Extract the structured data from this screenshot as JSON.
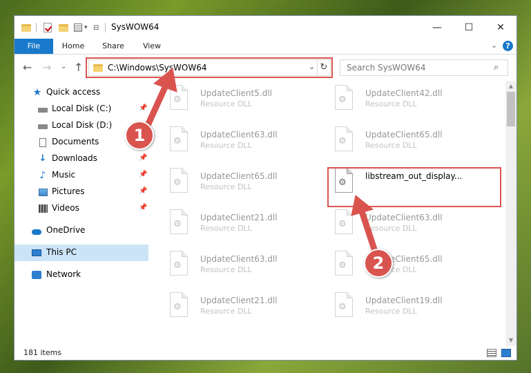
{
  "window": {
    "title": "SysWOW64",
    "controls": {
      "minimize": "—",
      "maximize": "☐",
      "close": "✕"
    }
  },
  "ribbon": {
    "tabs": [
      "File",
      "Home",
      "Share",
      "View"
    ],
    "expand_glyph": "⌄"
  },
  "nav": {
    "back": "←",
    "forward": "→",
    "recent": "⌄",
    "up": "↑",
    "address": "C:\\Windows\\SysWOW64",
    "refresh": "↻",
    "search_placeholder": "Search SysWOW64",
    "search_icon": "⌕"
  },
  "sidebar": {
    "items": [
      {
        "label": "Quick access",
        "icon": "star-icon",
        "pinned": false
      },
      {
        "label": "Local Disk (C:)",
        "icon": "disk-icon",
        "pinned": true
      },
      {
        "label": "Local Disk (D:)",
        "icon": "disk-icon",
        "pinned": false
      },
      {
        "label": "Documents",
        "icon": "documents-icon",
        "pinned": true
      },
      {
        "label": "Downloads",
        "icon": "downloads-icon",
        "pinned": true
      },
      {
        "label": "Music",
        "icon": "music-icon",
        "pinned": true
      },
      {
        "label": "Pictures",
        "icon": "pictures-icon",
        "pinned": true
      },
      {
        "label": "Videos",
        "icon": "videos-icon",
        "pinned": true
      },
      {
        "label": "OneDrive",
        "icon": "onedrive-icon",
        "pinned": false
      },
      {
        "label": "This PC",
        "icon": "this-pc-icon",
        "pinned": false,
        "selected": true
      },
      {
        "label": "Network",
        "icon": "network-icon",
        "pinned": false
      }
    ]
  },
  "files": [
    {
      "name": "UpdateClient5.dll",
      "type": "Resource DLL",
      "faded": true
    },
    {
      "name": "UpdateClient42.dll",
      "type": "Resource DLL",
      "faded": true
    },
    {
      "name": "UpdateClient63.dll",
      "type": "Resource DLL",
      "faded": true
    },
    {
      "name": "UpdateClient65.dll",
      "type": "Resource DLL",
      "faded": true
    },
    {
      "name": "UpdateClient65.dll",
      "type": "Resource DLL",
      "faded": true
    },
    {
      "name": "libstream_out_display...",
      "type": "",
      "faded": false
    },
    {
      "name": "UpdateClient21.dll",
      "type": "Resource DLL",
      "faded": true
    },
    {
      "name": "UpdateClient63.dll",
      "type": "Resource DLL",
      "faded": true
    },
    {
      "name": "UpdateClient63.dll",
      "type": "Resource DLL",
      "faded": true
    },
    {
      "name": "UpdateClient65.dll",
      "type": "Resource DLL",
      "faded": true
    },
    {
      "name": "UpdateClient21.dll",
      "type": "Resource DLL",
      "faded": true
    },
    {
      "name": "UpdateClient19.dll",
      "type": "Resource DLL",
      "faded": true
    }
  ],
  "status": {
    "item_count": "181 items"
  },
  "annotations": {
    "step1": "1",
    "step2": "2",
    "color": "#d9534f"
  },
  "colors": {
    "accent": "#1979ca",
    "selection": "#cce4f7",
    "highlight": "#d9534f"
  }
}
